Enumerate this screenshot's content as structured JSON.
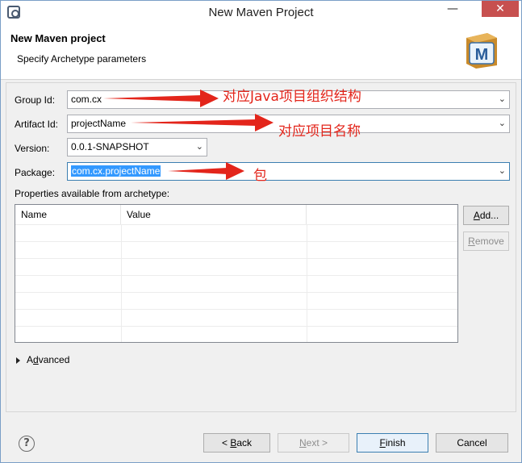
{
  "window": {
    "title": "New Maven Project",
    "minimize_glyph": "—",
    "close_glyph": "✕"
  },
  "banner": {
    "title": "New Maven project",
    "subtitle": "Specify Archetype parameters",
    "icon_letter": "M"
  },
  "form": {
    "group_id_label": "Group Id:",
    "group_id_value": "com.cx",
    "artifact_id_label": "Artifact Id:",
    "artifact_id_value": "projectName",
    "version_label": "Version:",
    "version_value": "0.0.1-SNAPSHOT",
    "package_label": "Package:",
    "package_value": "com.cx.projectName"
  },
  "properties": {
    "label": "Properties available from archetype:",
    "columns": [
      "Name",
      "Value"
    ],
    "rows": [],
    "add_button_u": "A",
    "add_button_rest": "dd...",
    "remove_button_u": "R",
    "remove_button_rest": "emove"
  },
  "advanced": {
    "label_pre": "A",
    "label_u": "d",
    "label_post": "vanced"
  },
  "footer": {
    "help_glyph": "?",
    "back_pre": "< ",
    "back_u": "B",
    "back_post": "ack",
    "next_u": "N",
    "next_post": "ext >",
    "finish_u": "F",
    "finish_post": "inish",
    "cancel_label": "Cancel"
  },
  "annotations": {
    "group_note": "对应Java项目组织结构",
    "artifact_note": "对应项目名称",
    "package_note": "包",
    "color": "#e3251b"
  }
}
